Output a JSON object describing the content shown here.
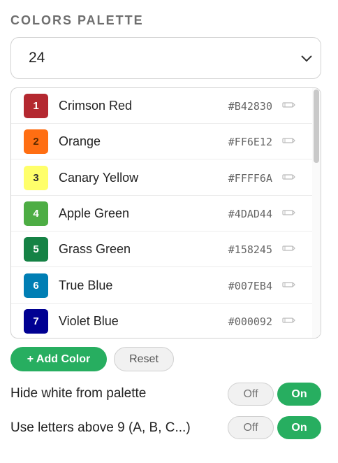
{
  "section_title": "COLORS PALETTE",
  "palette_size": {
    "selected": "24"
  },
  "colors": [
    {
      "num": "1",
      "name": "Crimson Red",
      "hex": "#B42830",
      "text_color": "#ffffff"
    },
    {
      "num": "2",
      "name": "Orange",
      "hex": "#FF6E12",
      "text_color": "#5a2a00"
    },
    {
      "num": "3",
      "name": "Canary Yellow",
      "hex": "#FFFF6A",
      "text_color": "#333333"
    },
    {
      "num": "4",
      "name": "Apple Green",
      "hex": "#4DAD44",
      "text_color": "#ffffff"
    },
    {
      "num": "5",
      "name": "Grass Green",
      "hex": "#158245",
      "text_color": "#ffffff"
    },
    {
      "num": "6",
      "name": "True Blue",
      "hex": "#007EB4",
      "text_color": "#ffffff"
    },
    {
      "num": "7",
      "name": "Violet Blue",
      "hex": "#000092",
      "text_color": "#ffffff"
    }
  ],
  "buttons": {
    "add_color": "+ Add Color",
    "reset": "Reset"
  },
  "options": [
    {
      "label": "Hide white from palette",
      "off": "Off",
      "on": "On",
      "state": "on"
    },
    {
      "label": "Use letters above 9 (A, B, C...)",
      "off": "Off",
      "on": "On",
      "state": "on"
    }
  ],
  "accent_color": "#27AE60"
}
